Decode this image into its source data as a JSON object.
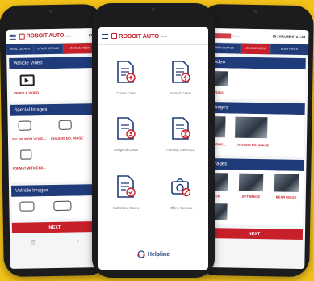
{
  "left_phone": {
    "logo_text": "ROBOIT AUTO",
    "logo_sub": "Worker",
    "header_right": "ID:",
    "steps": [
      "BASIC DETAILS",
      "OTHER DETAILS",
      "VEHICLE VIDEO"
    ],
    "vehicle_video": {
      "title": "Vehicle Video",
      "item_label": "VEHICLE VIDEO"
    },
    "special_images": {
      "title": "Special Images",
      "items": [
        "SELFIE WITH VEHIC...",
        "CHASSIS NO. IMAGE",
        "FORMAT WITH CHA..."
      ]
    },
    "vehicle_images": {
      "title": "Vehicle Images"
    },
    "next_label": "NEXT"
  },
  "middle_phone": {
    "logo_text": "ROBOIT AUTO",
    "logo_sub": "Worker",
    "grid": [
      {
        "label": "Create Case",
        "icon": "doc-plus-icon"
      },
      {
        "label": "Scored Cases",
        "icon": "doc-bolt-icon"
      },
      {
        "label": "Assigned Cases",
        "icon": "doc-user-icon"
      },
      {
        "label": "Pending Cases(12)",
        "icon": "doc-hourglass-icon"
      },
      {
        "label": "Submitted Cases",
        "icon": "doc-check-icon"
      },
      {
        "label": "Offline Camera",
        "icon": "camera-icon"
      }
    ],
    "helpline_label": "Helpline"
  },
  "right_phone": {
    "logo_sub": "Worker",
    "header_right": "ID: VALUE-0721-34",
    "steps": [
      "OTHER DETAILS",
      "VEHICLE VIDEO",
      "BODY PARTS"
    ],
    "vehicle_video": {
      "title": "Video",
      "item_label": "LE VIDEO"
    },
    "special_images": {
      "title": "Images",
      "items": [
        "ITH VEHIC...",
        "CHASSIS NO. IMAGE"
      ]
    },
    "vehicle_images": {
      "title": "Images",
      "items": [
        "T IMAGE",
        "LEFT IMAGE",
        "REAR IMAGE"
      ]
    },
    "next_label": "NEXT"
  },
  "colors": {
    "background": "#f3c21a",
    "brand_red": "#c8202a",
    "brand_blue": "#1f3b7a"
  }
}
